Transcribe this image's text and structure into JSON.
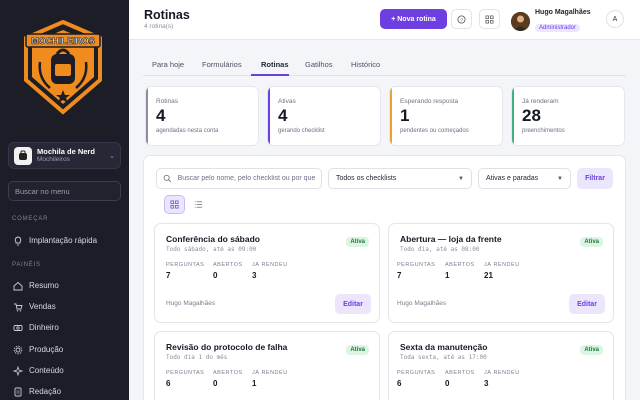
{
  "sidebar": {
    "org": {
      "name": "Mochila de Nerd",
      "sub": "Mochileiros"
    },
    "search_placeholder": "Buscar no menu",
    "sections": {
      "start": "COMEÇAR",
      "panels": "PAINÉIS"
    },
    "items": [
      {
        "label": "Implantação rápida",
        "icon": "lightbulb-icon"
      },
      {
        "label": "Resumo",
        "icon": "home-icon"
      },
      {
        "label": "Vendas",
        "icon": "cart-icon"
      },
      {
        "label": "Dinheiro",
        "icon": "money-icon"
      },
      {
        "label": "Produção",
        "icon": "gear-icon"
      },
      {
        "label": "Conteúdo",
        "icon": "sparkle-icon"
      },
      {
        "label": "Redação",
        "icon": "document-icon"
      }
    ],
    "logo_text": "MOCHILEIROS"
  },
  "header": {
    "title": "Rotinas",
    "subtitle": "4 rotina(s)",
    "new_button": "+ Nova rotina",
    "user": {
      "name": "Hugo Magalhães",
      "role": "Administrador",
      "initial": "A"
    }
  },
  "tabs": [
    "Para hoje",
    "Formulários",
    "Rotinas",
    "Gatilhos",
    "Histórico"
  ],
  "active_tab": "Rotinas",
  "stats": [
    {
      "label": "Rotinas",
      "value": "4",
      "sub": "agendadas nesta conta",
      "color": "#8a8ea0"
    },
    {
      "label": "Ativas",
      "value": "4",
      "sub": "gerando checklist",
      "color": "#6d3fe0"
    },
    {
      "label": "Esperando resposta",
      "value": "1",
      "sub": "pendentes ou começados",
      "color": "#f0a030"
    },
    {
      "label": "Já renderam",
      "value": "28",
      "sub": "preenchimentos",
      "color": "#3fb27f"
    }
  ],
  "filters": {
    "search_placeholder": "Buscar pelo nome, pelo checklist ou por quem",
    "checklist_select": "Todos os checklists",
    "status_select": "Ativas e paradas",
    "filter_button": "Filtrar"
  },
  "metric_labels": {
    "perguntas": "PERGUNTAS",
    "abertos": "ABERTOS",
    "rendeu": "JÁ RENDEU"
  },
  "edit_label": "Editar",
  "routines": [
    {
      "title": "Conferência do sábado",
      "schedule": "Todo sábado, até as 09:00",
      "status": "Ativa",
      "perguntas": "7",
      "abertos": "0",
      "rendeu": "3",
      "owner": "Hugo Magalhães"
    },
    {
      "title": "Abertura — loja da frente",
      "schedule": "Todo dia, até as 08:00",
      "status": "Ativa",
      "perguntas": "7",
      "abertos": "1",
      "rendeu": "21",
      "owner": "Hugo Magalhães"
    },
    {
      "title": "Revisão do protocolo de falha",
      "schedule": "Todo dia 1 do mês",
      "status": "Ativa",
      "perguntas": "6",
      "abertos": "0",
      "rendeu": "1",
      "owner": ""
    },
    {
      "title": "Sexta da manutenção",
      "schedule": "Toda sexta, até as 17:00",
      "status": "Ativa",
      "perguntas": "6",
      "abertos": "0",
      "rendeu": "3",
      "owner": ""
    }
  ],
  "colors": {
    "accent": "#6d3fe0",
    "sidebar_bg": "#1c1d27",
    "logo_orange": "#f08c1e",
    "active_badge": "#1a7a3a"
  }
}
